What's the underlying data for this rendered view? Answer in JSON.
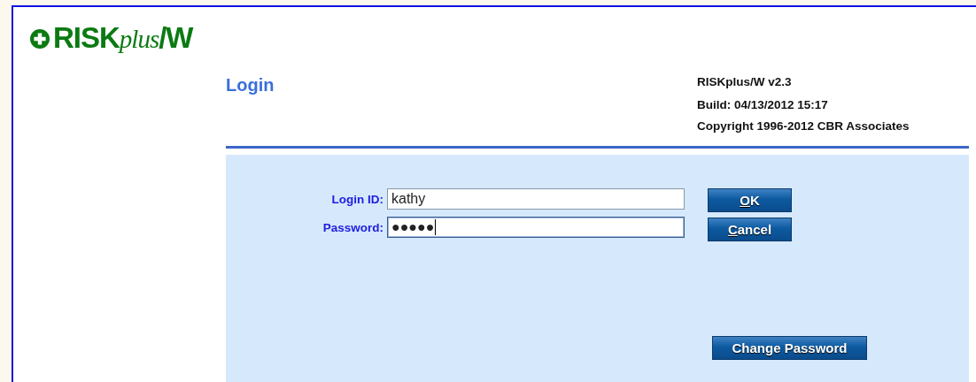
{
  "logo": {
    "parts": [
      {
        "kind": "plain",
        "text": "RISK"
      },
      {
        "kind": "script",
        "text": "plus"
      },
      {
        "kind": "plain",
        "text": "/W"
      }
    ]
  },
  "page_title": "Login",
  "about": [
    "RISKplus/W v2.3",
    "Build: 04/13/2012 15:17",
    "Copyright 1996-2012 CBR Associates"
  ],
  "fields": [
    {
      "label": "Login ID:",
      "value": "kathy",
      "focused": false
    },
    {
      "label": "Password:",
      "value": "●●●●●",
      "focused": true
    }
  ],
  "buttons": [
    {
      "mnemonic": "O",
      "rest": "K"
    },
    {
      "mnemonic": "C",
      "rest": "ancel"
    }
  ],
  "change_password": "Change Password"
}
